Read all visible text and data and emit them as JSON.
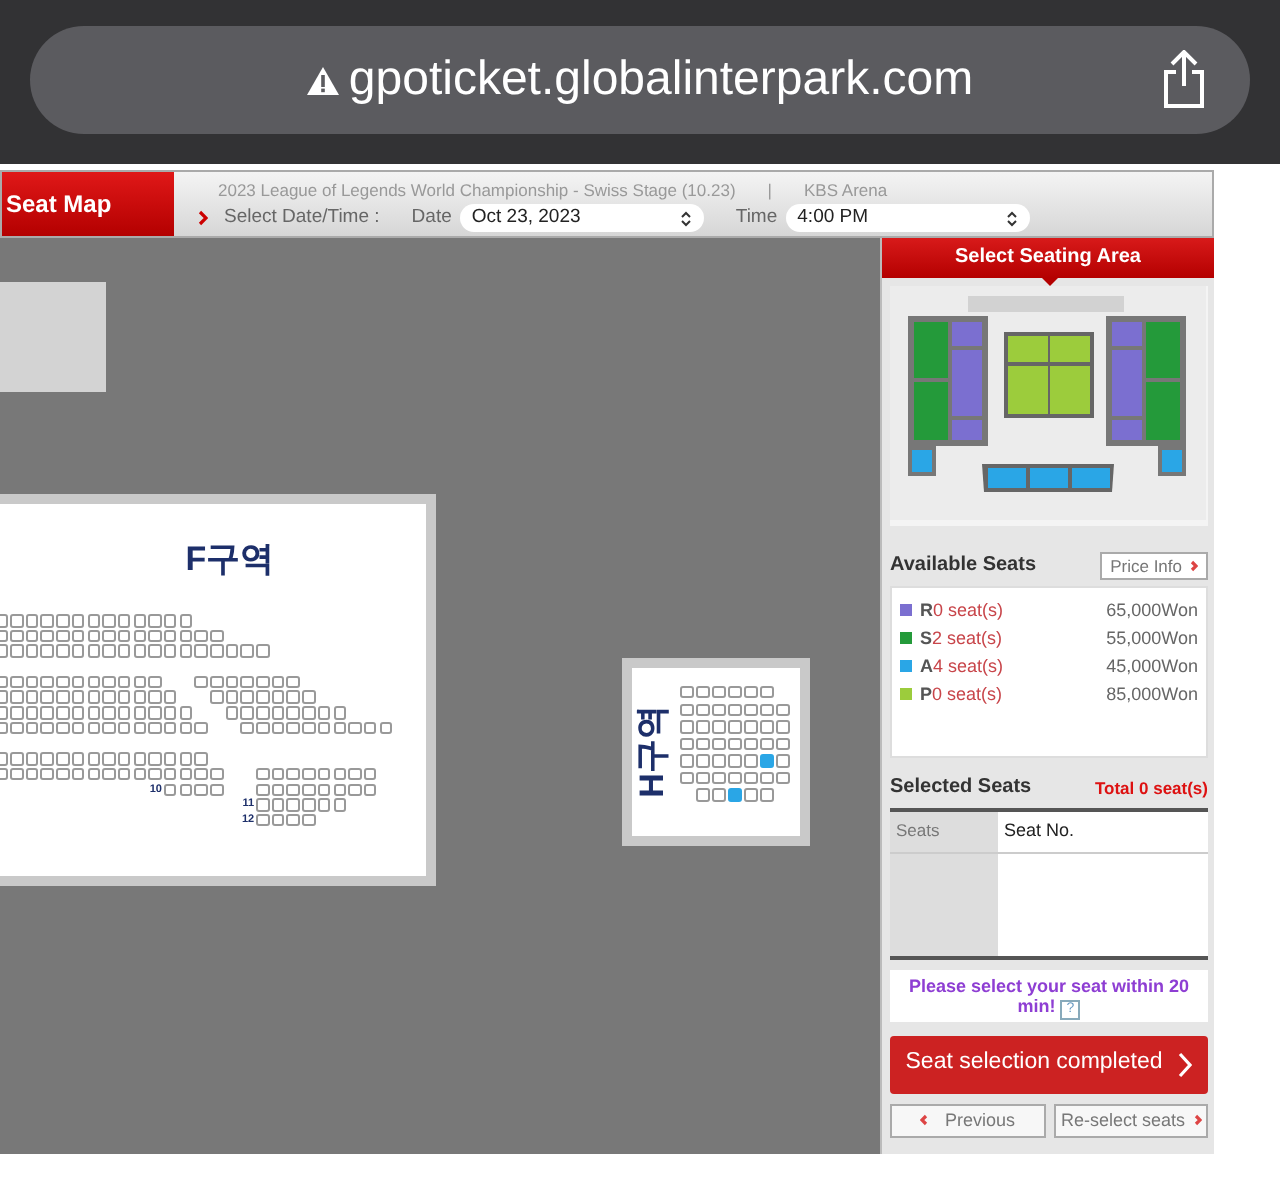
{
  "browser": {
    "url": "gpoticket.globalinterpark.com"
  },
  "header": {
    "tab": "Seat Map",
    "event": "2023 League of Legends World Championship - Swiss Stage (10.23)",
    "separator": "|",
    "venue": "KBS Arena",
    "prompt": "Select Date/Time :",
    "date_label": "Date",
    "date_value": "Oct 23, 2023",
    "time_label": "Time",
    "time_value": "4:00 PM"
  },
  "map": {
    "sections": [
      {
        "kind": "blank"
      },
      {
        "kind": "block",
        "title": "F구역",
        "row_labels": [
          "10",
          "11",
          "12"
        ]
      },
      {
        "kind": "vertical",
        "title": "H구역",
        "rows": [
          [
            {
              "available": false
            },
            {
              "available": false
            },
            {
              "available": false
            },
            {
              "available": false
            },
            {
              "available": false
            },
            {
              "available": false
            }
          ],
          [
            {
              "available": false
            },
            {
              "available": false
            },
            {
              "available": false
            },
            {
              "available": false
            },
            {
              "available": false
            },
            {
              "available": false
            },
            {
              "available": false
            }
          ],
          [
            {
              "available": false
            },
            {
              "available": false
            },
            {
              "available": false
            },
            {
              "available": false
            },
            {
              "available": false
            },
            {
              "available": false
            },
            {
              "available": false
            }
          ],
          [
            {
              "available": false
            },
            {
              "available": false
            },
            {
              "available": false
            },
            {
              "available": false
            },
            {
              "available": false
            },
            {
              "available": false
            },
            {
              "available": false
            }
          ],
          [
            {
              "available": false
            },
            {
              "available": false
            },
            {
              "available": false
            },
            {
              "available": false
            },
            {
              "available": false
            },
            {
              "available": true
            },
            {
              "available": false
            }
          ],
          [
            {
              "available": false
            },
            {
              "available": false
            },
            {
              "available": false
            },
            {
              "available": false
            },
            {
              "available": false
            },
            {
              "available": false
            },
            {
              "available": false
            }
          ],
          [
            {
              "available": false
            },
            {
              "available": false
            },
            {
              "available": true
            },
            {
              "available": false
            },
            {
              "available": false
            }
          ]
        ]
      }
    ]
  },
  "panel": {
    "title": "Select Seating Area",
    "available": {
      "title": "Available Seats",
      "price_button": "Price Info",
      "grades": [
        {
          "grade": "R",
          "count": "0 seat(s)",
          "price": "65,000Won",
          "color": "#7b6fd0"
        },
        {
          "grade": "S",
          "count": "2 seat(s)",
          "price": "55,000Won",
          "color": "#249a3a"
        },
        {
          "grade": "A",
          "count": "4 seat(s)",
          "price": "45,000Won",
          "color": "#2aa6e6"
        },
        {
          "grade": "P",
          "count": "0 seat(s)",
          "price": "85,000Won",
          "color": "#9ccc3c"
        }
      ]
    },
    "selected": {
      "title": "Selected Seats",
      "total": "Total 0 seat(s)",
      "columns": [
        "Seats",
        "Seat No."
      ]
    },
    "notice": "Please select your seat within 20 min!",
    "help": "?",
    "complete_button": "Seat selection completed",
    "previous_button": "Previous",
    "reselect_button": "Re-select seats"
  }
}
